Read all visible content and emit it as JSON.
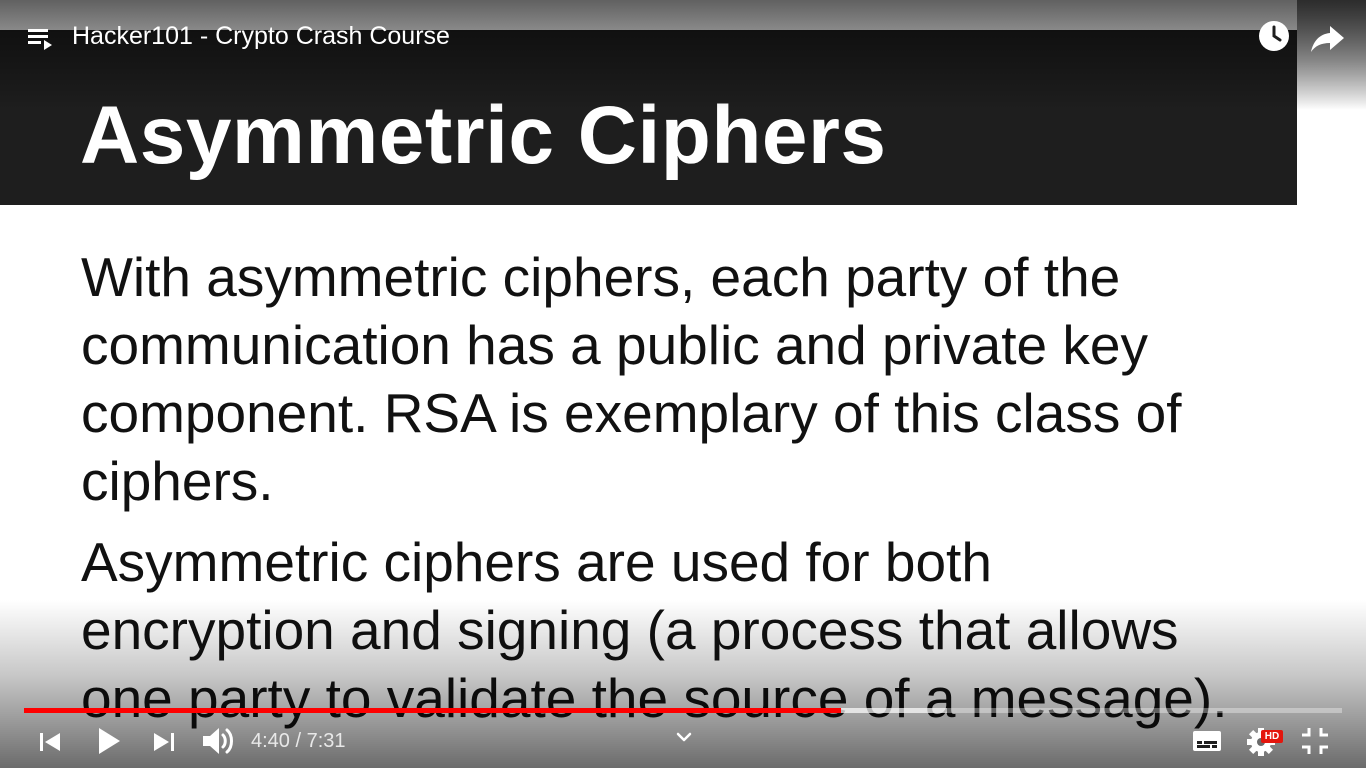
{
  "player": {
    "video_title": "Hacker101 - Crypto Crash Course",
    "time": {
      "current": "4:40",
      "separator": "/",
      "duration": "7:31",
      "display": "4:40 / 7:31"
    },
    "progress": {
      "played_fraction": 0.62,
      "buffered_fraction": 0.7
    },
    "hd_badge": "HD",
    "accent_color": "#ff0000",
    "icons": {
      "playlist": "playlist-icon",
      "watch_later": "clock-icon",
      "share": "share-arrow-icon",
      "previous": "skip-previous-icon",
      "play": "play-icon",
      "next": "skip-next-icon",
      "volume": "volume-icon",
      "chevron": "chevron-down-icon",
      "subtitles": "subtitles-icon",
      "settings": "gear-icon",
      "exit_fullscreen": "exit-fullscreen-icon"
    }
  },
  "slide": {
    "title": "Asymmetric Ciphers",
    "paragraph_1": "With asymmetric ciphers, each party of the\ncommunication has a public and private key\ncomponent.  RSA is exemplary of this class of\nciphers.",
    "paragraph_2": "Asymmetric ciphers are used for both\nencryption and signing (a process that allows\none party to validate the source of a message).",
    "colors": {
      "title_bar": "#1e1e1e",
      "title_text": "#ffffff",
      "body_text": "#111111",
      "background": "#ffffff"
    }
  }
}
